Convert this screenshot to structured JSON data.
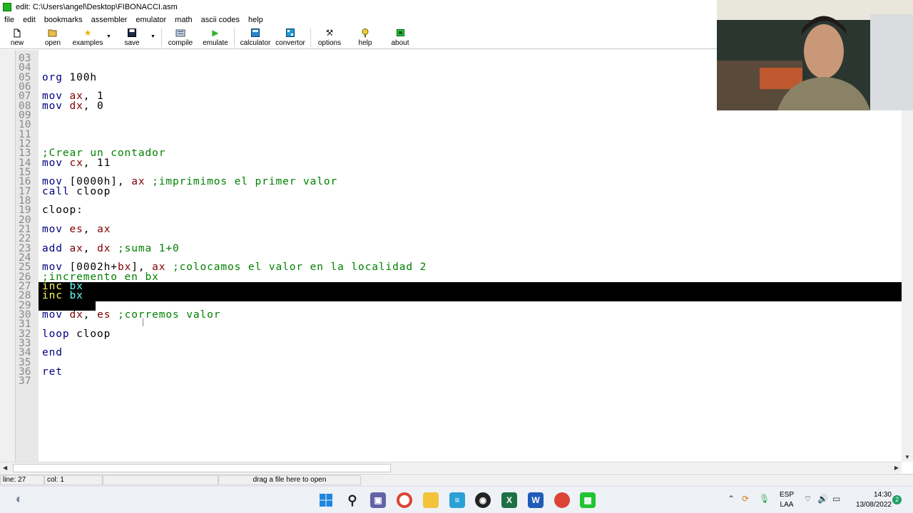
{
  "window": {
    "title": "edit: C:\\Users\\angel\\Desktop\\FIBONACCI.asm"
  },
  "menu": [
    "file",
    "edit",
    "bookmarks",
    "assembler",
    "emulator",
    "math",
    "ascii codes",
    "help"
  ],
  "toolbar": {
    "new": "new",
    "open": "open",
    "examples": "examples",
    "save": "save",
    "compile": "compile",
    "emulate": "emulate",
    "calculator": "calculator",
    "convertor": "convertor",
    "options": "options",
    "help": "help",
    "about": "about"
  },
  "editor": {
    "lines": [
      {
        "n": "03",
        "code": ""
      },
      {
        "n": "04",
        "code": ""
      },
      {
        "n": "05",
        "code": "org 100h"
      },
      {
        "n": "06",
        "code": ""
      },
      {
        "n": "07",
        "code": "mov ax, 1"
      },
      {
        "n": "08",
        "code": "mov dx, 0"
      },
      {
        "n": "09",
        "code": ""
      },
      {
        "n": "10",
        "code": ""
      },
      {
        "n": "11",
        "code": ""
      },
      {
        "n": "12",
        "code": ""
      },
      {
        "n": "13",
        "code": ";Crear un contador"
      },
      {
        "n": "14",
        "code": "mov cx, 11"
      },
      {
        "n": "15",
        "code": ""
      },
      {
        "n": "16",
        "code": "mov [0000h], ax ;imprimimos el primer valor"
      },
      {
        "n": "17",
        "code": "call cloop"
      },
      {
        "n": "18",
        "code": ""
      },
      {
        "n": "19",
        "code": "cloop:"
      },
      {
        "n": "20",
        "code": ""
      },
      {
        "n": "21",
        "code": "mov es, ax"
      },
      {
        "n": "22",
        "code": ""
      },
      {
        "n": "23",
        "code": "add ax, dx ;suma 1+0"
      },
      {
        "n": "24",
        "code": ""
      },
      {
        "n": "25",
        "code": "mov [0002h+bx], ax ;colocamos el valor en la localidad 2"
      },
      {
        "n": "26",
        "code": ";incremento en bx"
      },
      {
        "n": "27",
        "code": "inc bx"
      },
      {
        "n": "28",
        "code": "inc bx"
      },
      {
        "n": "29",
        "code": ""
      },
      {
        "n": "30",
        "code": "mov dx, es ;corremos valor"
      },
      {
        "n": "31",
        "code": ""
      },
      {
        "n": "32",
        "code": "loop cloop"
      },
      {
        "n": "33",
        "code": ""
      },
      {
        "n": "34",
        "code": "end"
      },
      {
        "n": "35",
        "code": ""
      },
      {
        "n": "36",
        "code": "ret"
      },
      {
        "n": "37",
        "code": ""
      }
    ],
    "selected_lines": [
      "27",
      "28"
    ]
  },
  "status": {
    "line": "line: 27",
    "col": "col: 1",
    "drop_hint": "drag a file here to open"
  },
  "taskbar": {
    "language_line1": "ESP",
    "language_line2": "LAA",
    "time": "14:30",
    "date": "13/08/2022",
    "notifications": "2"
  },
  "colors": {
    "keyword": "#000080",
    "register": "#800000",
    "comment": "#008000",
    "selection_bg": "#000000"
  }
}
